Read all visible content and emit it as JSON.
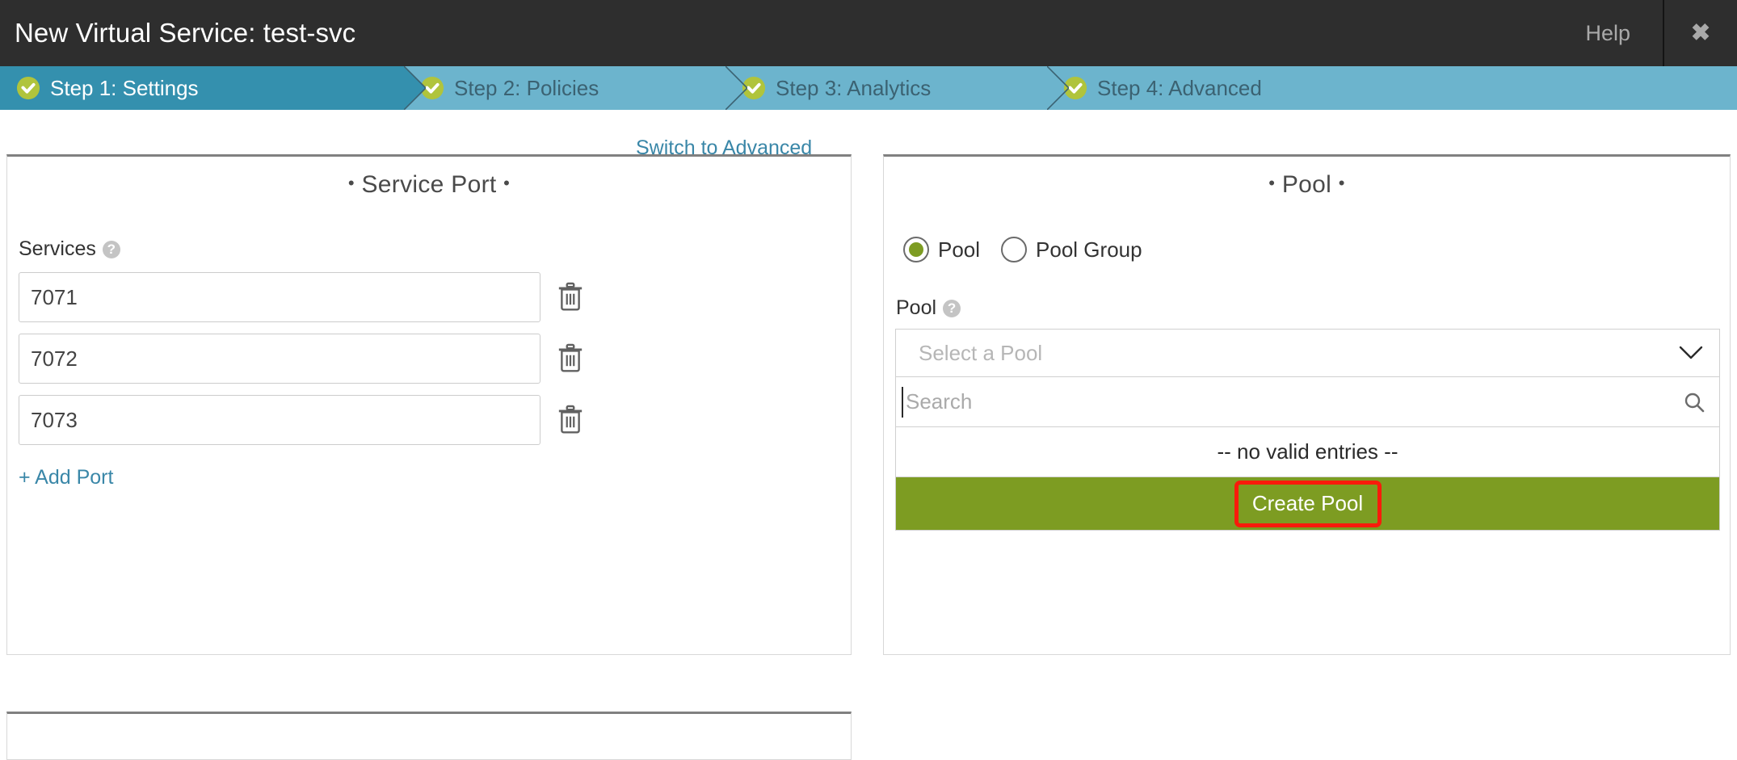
{
  "titlebar": {
    "title": "New Virtual Service: test-svc",
    "help_label": "Help",
    "close_label": "✖"
  },
  "steps": [
    {
      "label": "Step 1: Settings",
      "icon": "check-circle-icon",
      "active": true
    },
    {
      "label": "Step 2: Policies",
      "icon": "check-circle-icon",
      "active": false
    },
    {
      "label": "Step 3: Analytics",
      "icon": "check-circle-icon",
      "active": false
    },
    {
      "label": "Step 4: Advanced",
      "icon": "check-circle-icon",
      "active": false
    }
  ],
  "service_port": {
    "title_text": "Service Port",
    "bullet": "•",
    "switch_link": "Switch to Advanced",
    "services_label": "Services",
    "help_icon_glyph": "?",
    "ports": [
      {
        "value": "7071",
        "delete_icon": "trash-icon"
      },
      {
        "value": "7072",
        "delete_icon": "trash-icon"
      },
      {
        "value": "7073",
        "delete_icon": "trash-icon"
      }
    ],
    "add_port_label": "+ Add Port"
  },
  "pool": {
    "title_text": "Pool",
    "bullet": "•",
    "radio_options": [
      {
        "label": "Pool",
        "selected": true
      },
      {
        "label": "Pool Group",
        "selected": false
      }
    ],
    "field_label": "Pool",
    "help_icon_glyph": "?",
    "select_placeholder": "Select a Pool",
    "chevron_icon": "chevron-down-icon",
    "search_placeholder": "Search",
    "search_value": "",
    "search_icon": "search-icon",
    "no_entries_text": "-- no valid entries --",
    "create_pool_label": "Create Pool"
  },
  "colors": {
    "titlebar_bg": "#2e2e2e",
    "step_active_bg": "#3490ae",
    "step_inactive_bg": "#6cb4cd",
    "check_green": "#b0c43c",
    "link_blue": "#3a87a8",
    "action_green": "#7d9c22",
    "highlight_red": "#f81b0b"
  }
}
